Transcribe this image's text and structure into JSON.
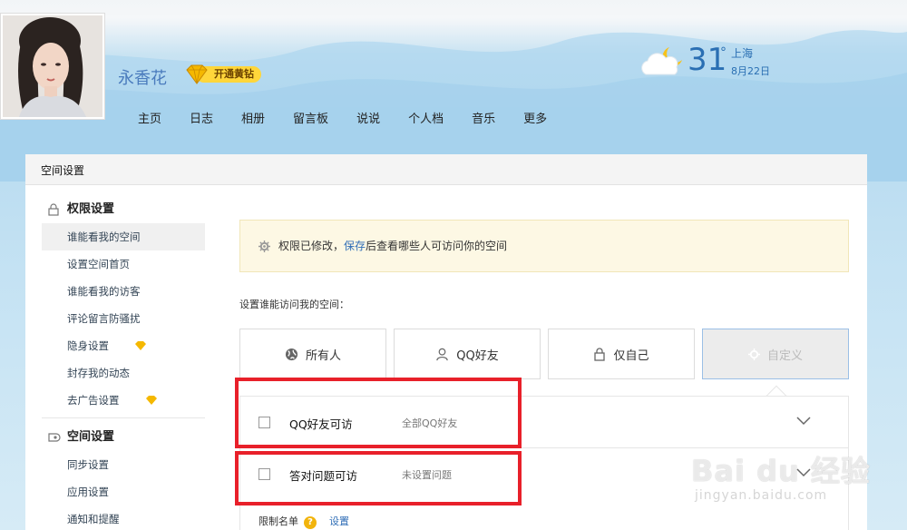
{
  "profile": {
    "name": "永香花",
    "vip_label": "开通黄钻"
  },
  "nav": {
    "items": [
      "主页",
      "日志",
      "相册",
      "留言板",
      "说说",
      "个人档",
      "音乐",
      "更多"
    ]
  },
  "weather": {
    "temp": "31",
    "unit": "°",
    "city": "上海",
    "date": "8月22日"
  },
  "panel": {
    "title": "空间设置"
  },
  "sidebar": {
    "group1": {
      "label": "权限设置",
      "icon": "lock-icon"
    },
    "items1": [
      "谁能看我的空间",
      "设置空间首页",
      "谁能看我的访客",
      "评论留言防骚扰",
      "隐身设置",
      "封存我的动态",
      "去广告设置"
    ],
    "group2": {
      "label": "空间设置",
      "icon": "gear-icon"
    },
    "items2": [
      "同步设置",
      "应用设置",
      "通知和提醒"
    ]
  },
  "notice": {
    "before": "权限已修改，",
    "link": "保存",
    "after": "后查看哪些人可访问你的空间"
  },
  "access": {
    "label": "设置谁能访问我的空间：",
    "options": [
      "所有人",
      "QQ好友",
      "仅自己",
      "自定义"
    ],
    "selected": "自定义"
  },
  "custom": {
    "rows": [
      {
        "name": "QQ好友可访",
        "desc": "全部QQ好友"
      },
      {
        "name": "答对问题可访",
        "desc": "未设置问题"
      }
    ],
    "limit_label": "限制名单",
    "limit_help": "?",
    "limit_link": "设置"
  },
  "watermark": {
    "brand": "Bai du 经验",
    "url": "jingyan.baidu.com"
  },
  "colors": {
    "accent": "#2f6db6",
    "highlight": "#e8202a",
    "vip": "#ffd63a"
  }
}
